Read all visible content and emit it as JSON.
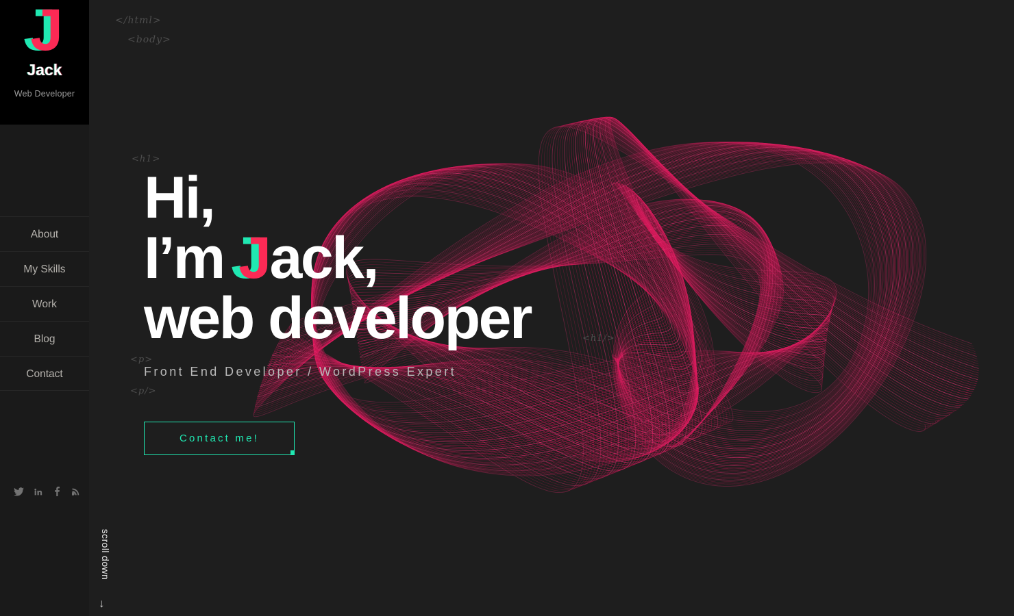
{
  "brand": {
    "logo_letter": "J",
    "name": "Jack",
    "role": "Web Developer",
    "accent_pink": "#fb2a55",
    "accent_teal": "#20e8b2"
  },
  "sidebar": {
    "nav": [
      {
        "label": "About"
      },
      {
        "label": "My Skills"
      },
      {
        "label": "Work"
      },
      {
        "label": "Blog"
      },
      {
        "label": "Contact"
      }
    ],
    "social": [
      {
        "icon": "twitter-icon",
        "label": "Twitter"
      },
      {
        "icon": "linkedin-icon",
        "label": "LinkedIn"
      },
      {
        "icon": "facebook-icon",
        "label": "Facebook"
      },
      {
        "icon": "rss-icon",
        "label": "RSS"
      }
    ]
  },
  "code_tags": {
    "html_close": "</html>",
    "body_open": "<body>",
    "h1_open": "<h1>",
    "h1_close": "<h1/>",
    "p_open": "<p>",
    "p_close": "<p/>"
  },
  "hero": {
    "line1": "Hi,",
    "line2_pre": "I’m ",
    "line2_j": "J",
    "line2_post": "ack,",
    "line3": "web developer",
    "subtitle": "Front End Developer / WordPress Expert",
    "cta_label": "Contact me!"
  },
  "scroll": {
    "label": "scroll down",
    "arrow": "↓"
  },
  "artwork": {
    "type": "harmonograph-attractor",
    "stroke_color": "#e8145c",
    "glow_color": "#ff2f7a"
  }
}
